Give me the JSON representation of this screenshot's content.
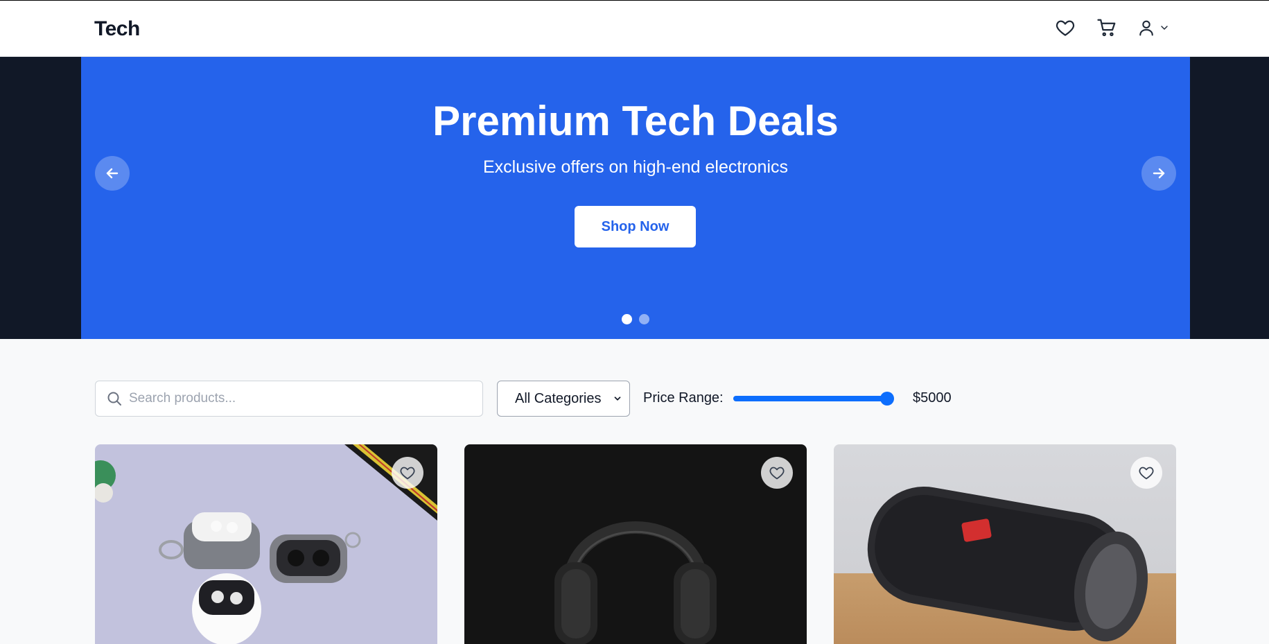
{
  "header": {
    "logo": "Tech"
  },
  "hero": {
    "title": "Premium Tech Deals",
    "subtitle": "Exclusive offers on high-end electronics",
    "cta_label": "Shop Now",
    "slides": 2,
    "active_slide": 1
  },
  "filters": {
    "search_placeholder": "Search products...",
    "category_selected": "All Categories",
    "price_label": "Price Range:",
    "price_value": "$5000",
    "price_fraction": 1.0
  },
  "products": [
    {
      "image": "earbuds-cases-photo",
      "icon": "heart-icon"
    },
    {
      "image": "over-ear-headphones-photo",
      "icon": "heart-icon"
    },
    {
      "image": "portable-speaker-photo",
      "icon": "heart-icon"
    }
  ],
  "colors": {
    "primary": "#2563eb",
    "hero_backdrop": "#111827",
    "slider": "#0d6efd",
    "page_bg": "#f8f9fa"
  }
}
